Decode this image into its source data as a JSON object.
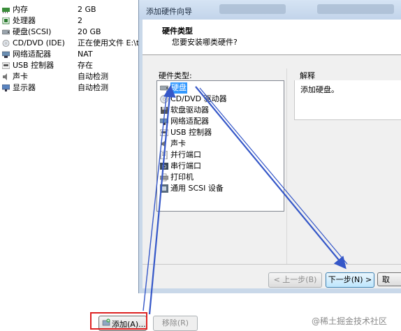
{
  "devices": [
    {
      "icon": "memory-icon",
      "name": "内存",
      "value": "2 GB"
    },
    {
      "icon": "cpu-icon",
      "name": "处理器",
      "value": "2"
    },
    {
      "icon": "harddisk-icon",
      "name": "硬盘(SCSI)",
      "value": "20 GB"
    },
    {
      "icon": "cd-dvd-icon",
      "name": "CD/DVD (IDE)",
      "value": "正在使用文件 E:\\toc"
    },
    {
      "icon": "network-icon",
      "name": "网络适配器",
      "value": "NAT"
    },
    {
      "icon": "usb-icon",
      "name": "USB 控制器",
      "value": "存在"
    },
    {
      "icon": "sound-icon",
      "name": "声卡",
      "value": "自动检测"
    },
    {
      "icon": "display-icon",
      "name": "显示器",
      "value": "自动检测"
    }
  ],
  "dialog": {
    "title": "添加硬件向导",
    "header_title": "硬件类型",
    "header_subtitle": "您要安装哪类硬件?",
    "types_label": "硬件类型:",
    "desc_label": "解释",
    "desc_text": "添加硬盘。",
    "items": [
      {
        "icon": "harddisk-icon",
        "label": "硬盘",
        "selected": true
      },
      {
        "icon": "cd-dvd-icon",
        "label": "CD/DVD 驱动器",
        "selected": false
      },
      {
        "icon": "floppy-icon",
        "label": "软盘驱动器",
        "selected": false
      },
      {
        "icon": "network-icon",
        "label": "网络适配器",
        "selected": false
      },
      {
        "icon": "usb-icon",
        "label": "USB 控制器",
        "selected": false
      },
      {
        "icon": "sound-icon",
        "label": "声卡",
        "selected": false
      },
      {
        "icon": "parallel-port-icon",
        "label": "并行端口",
        "selected": false
      },
      {
        "icon": "serial-port-icon",
        "label": "串行端口",
        "selected": false
      },
      {
        "icon": "printer-icon",
        "label": "打印机",
        "selected": false
      },
      {
        "icon": "scsi-device-icon",
        "label": "通用 SCSI 设备",
        "selected": false
      }
    ],
    "buttons": {
      "back": "< 上一步(B)",
      "next": "下一步(N) >",
      "cancel": "取"
    }
  },
  "bottom_buttons": {
    "add": "添加(A)...",
    "remove": "移除(R)"
  },
  "watermark": "@稀土掘金技术社区",
  "colors": {
    "selection": "#3399ff",
    "arrow": "#3557c8",
    "highlight": "#dd2222"
  }
}
